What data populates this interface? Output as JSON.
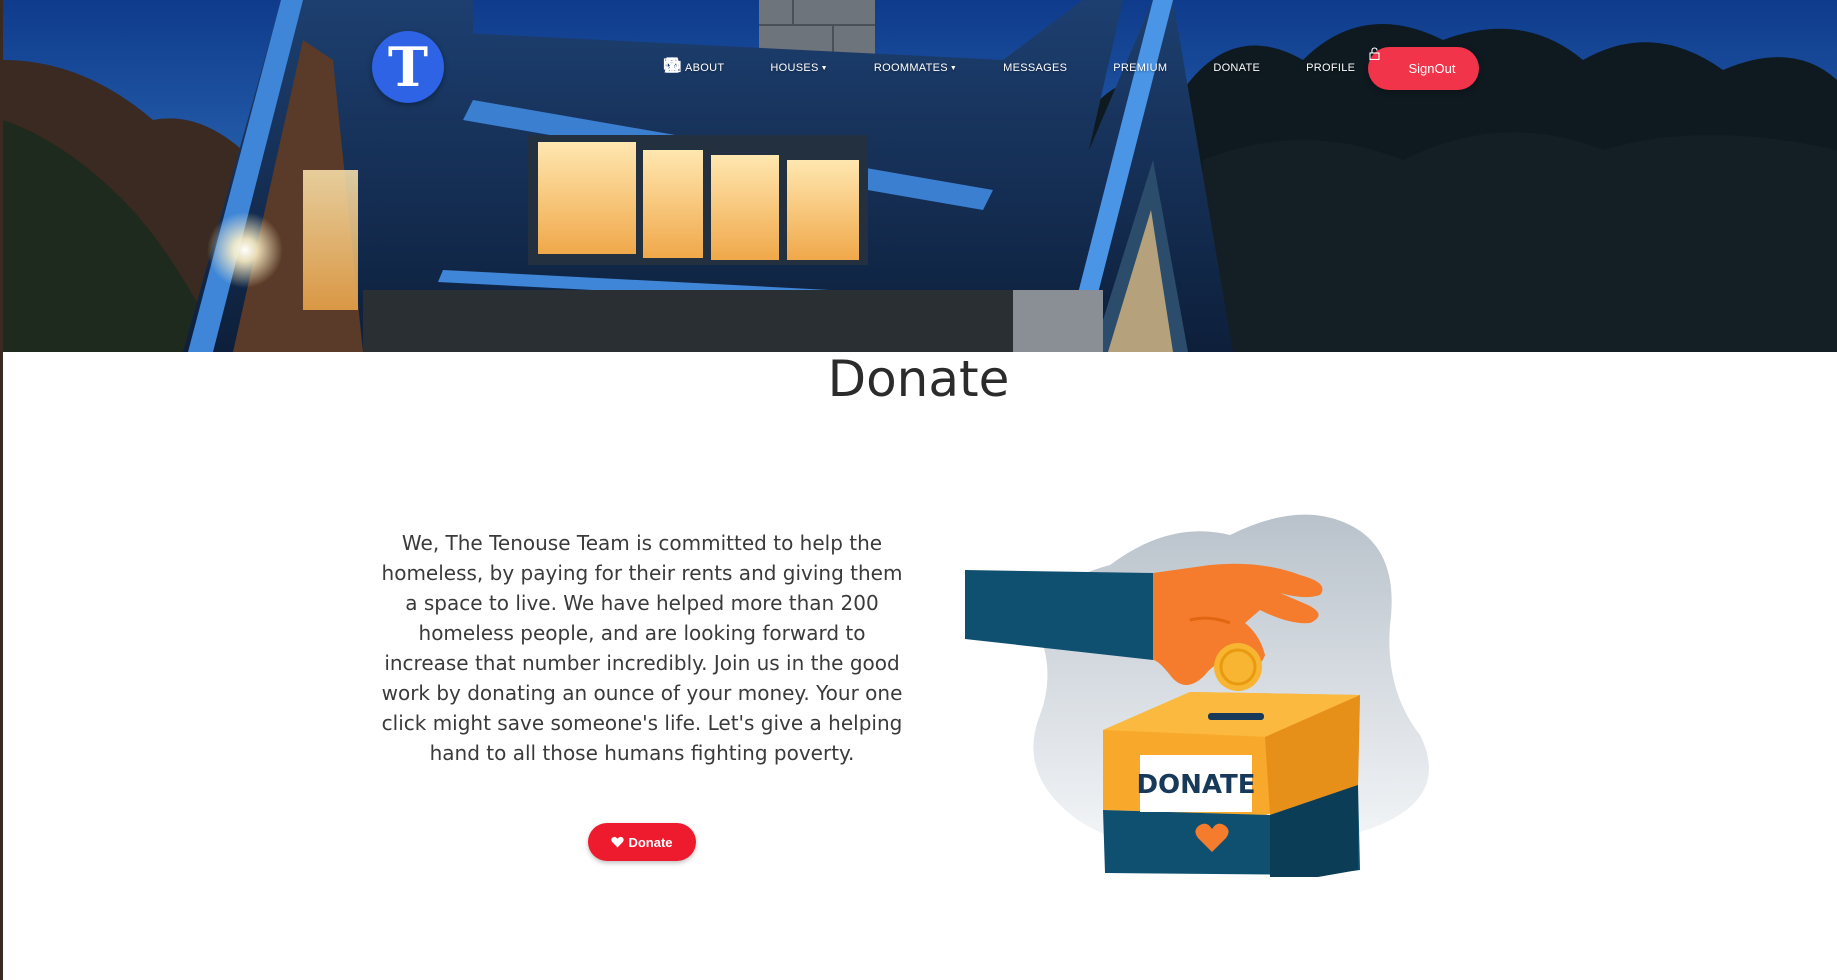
{
  "brand": {
    "logo_letter": "T"
  },
  "nav": {
    "items": [
      {
        "label": "ABOUT",
        "icon": "cloud-icon",
        "dropdown": false
      },
      {
        "label": "HOUSES",
        "icon": "house-icon",
        "dropdown": true
      },
      {
        "label": "ROOMMATES",
        "icon": "user-circle-icon",
        "dropdown": true
      },
      {
        "label": "MESSAGES",
        "icon": "chat-icon",
        "dropdown": false
      },
      {
        "label": "PREMIUM",
        "icon": "bookmark-icon",
        "dropdown": false
      },
      {
        "label": "DONATE",
        "icon": "donate-icon",
        "dropdown": false
      },
      {
        "label": "PROFILE",
        "icon": "user-icon",
        "dropdown": false
      }
    ],
    "signout_label": "SignOut"
  },
  "main": {
    "title": "Donate",
    "intro": "We, The Tenouse Team is committed to help the homeless, by paying for their rents and giving them a space to live. We have helped more than 200 homeless people, and are looking forward to increase that number incredibly. Join us in the good work by donating an ounce of your money. Your one click might save someone's life. Let's give a helping hand to all those humans fighting poverty.",
    "donate_button": "Donate",
    "illustration": {
      "box_label": "DONATE"
    }
  },
  "colors": {
    "accent_red": "#f2344b",
    "donate_red": "#ee1b2e",
    "logo_blue": "#2e63e6"
  }
}
